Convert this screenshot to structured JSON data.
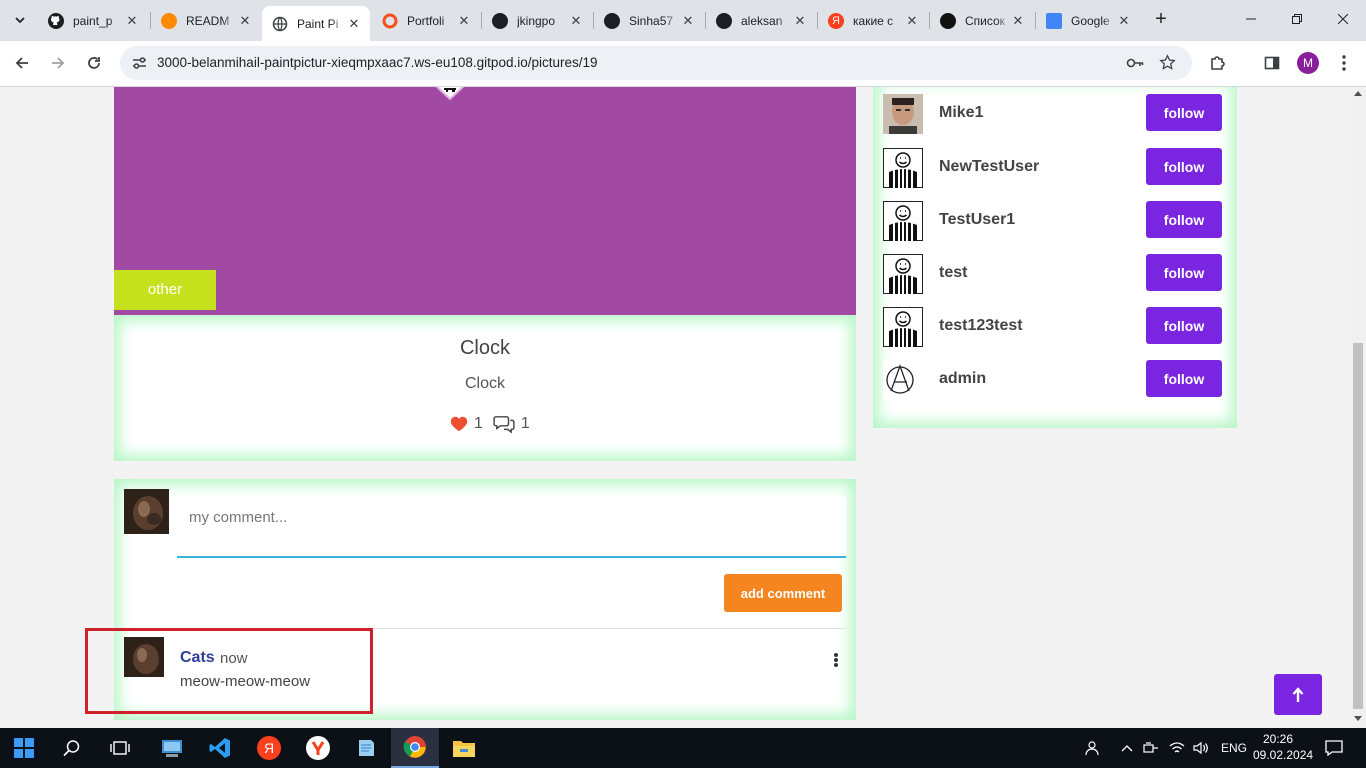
{
  "browser": {
    "tabs": [
      {
        "title": "paint_p",
        "icon": "github-icon",
        "active": false
      },
      {
        "title": "READM",
        "icon": "gitpod-icon",
        "active": false
      },
      {
        "title": "Paint Pi",
        "icon": "globe-icon",
        "active": true
      },
      {
        "title": "Portfoli",
        "icon": "portfolio-icon",
        "active": false
      },
      {
        "title": "jkingpo",
        "icon": "github-icon",
        "active": false
      },
      {
        "title": "Sinha57",
        "icon": "github-icon",
        "active": false
      },
      {
        "title": "aleksan",
        "icon": "github-icon",
        "active": false
      },
      {
        "title": "какие с",
        "icon": "yandex-icon",
        "active": false
      },
      {
        "title": "Список",
        "icon": "chatgpt-icon",
        "active": false
      },
      {
        "title": "Google",
        "icon": "google-translate-icon",
        "active": false
      }
    ],
    "url": "3000-belanmihail-paintpictur-xieqmpxaac7.ws-eu108.gitpod.io/pictures/19",
    "profile_initial": "M"
  },
  "picture": {
    "category": "other",
    "title": "Clock",
    "description": "Clock",
    "likes": "1",
    "comments_count": "1",
    "colors": {
      "picture_bg": "#a24aa3",
      "category_bg": "#c5e01d",
      "like": "#ef4d2f"
    }
  },
  "comment_form": {
    "placeholder": "my comment...",
    "submit_label": "add comment"
  },
  "comments": [
    {
      "author": "Cats",
      "time": "now",
      "text": "meow-meow-meow"
    }
  ],
  "users": [
    {
      "name": "Mike1",
      "avatar": "photo",
      "follow_label": "follow"
    },
    {
      "name": "NewTestUser",
      "avatar": "striped",
      "follow_label": "follow"
    },
    {
      "name": "TestUser1",
      "avatar": "striped",
      "follow_label": "follow"
    },
    {
      "name": "test",
      "avatar": "striped",
      "follow_label": "follow"
    },
    {
      "name": "test123test",
      "avatar": "striped",
      "follow_label": "follow"
    },
    {
      "name": "admin",
      "avatar": "anarchy",
      "follow_label": "follow"
    }
  ],
  "accent_colors": {
    "follow": "#7a25e0",
    "add_comment": "#f4851f",
    "highlight": "#d0202a"
  },
  "taskbar": {
    "language": "ENG",
    "time": "20:26",
    "date": "09.02.2024"
  }
}
